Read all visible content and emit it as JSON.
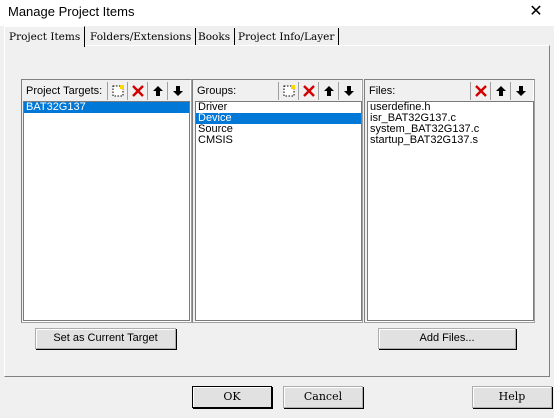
{
  "window": {
    "title": "Manage Project Items",
    "close_glyph": "✕"
  },
  "tabs": [
    {
      "label": "Project Items"
    },
    {
      "label": "Folders/Extensions"
    },
    {
      "label": "Books"
    },
    {
      "label": "Project Info/Layer"
    }
  ],
  "targets": {
    "label": "Project Targets:",
    "items": [
      "BAT32G137"
    ],
    "selected_index": 0
  },
  "groups": {
    "label": "Groups:",
    "items": [
      "Driver",
      "Device",
      "Source",
      "CMSIS"
    ],
    "selected_index": 1
  },
  "files": {
    "label": "Files:",
    "items": [
      "userdefine.h",
      "isr_BAT32G137.c",
      "system_BAT32G137.c",
      "startup_BAT32G137.s"
    ]
  },
  "icons": {
    "new": "new-icon",
    "delete": "delete-icon",
    "up": "arrow-up-icon",
    "down": "arrow-down-icon"
  },
  "buttons": {
    "set_current": "Set as Current Target",
    "add_files": "Add Files...",
    "ok": "OK",
    "cancel": "Cancel",
    "help": "Help"
  },
  "colors": {
    "selection": "#0078d7",
    "delete_red": "#d40000"
  }
}
